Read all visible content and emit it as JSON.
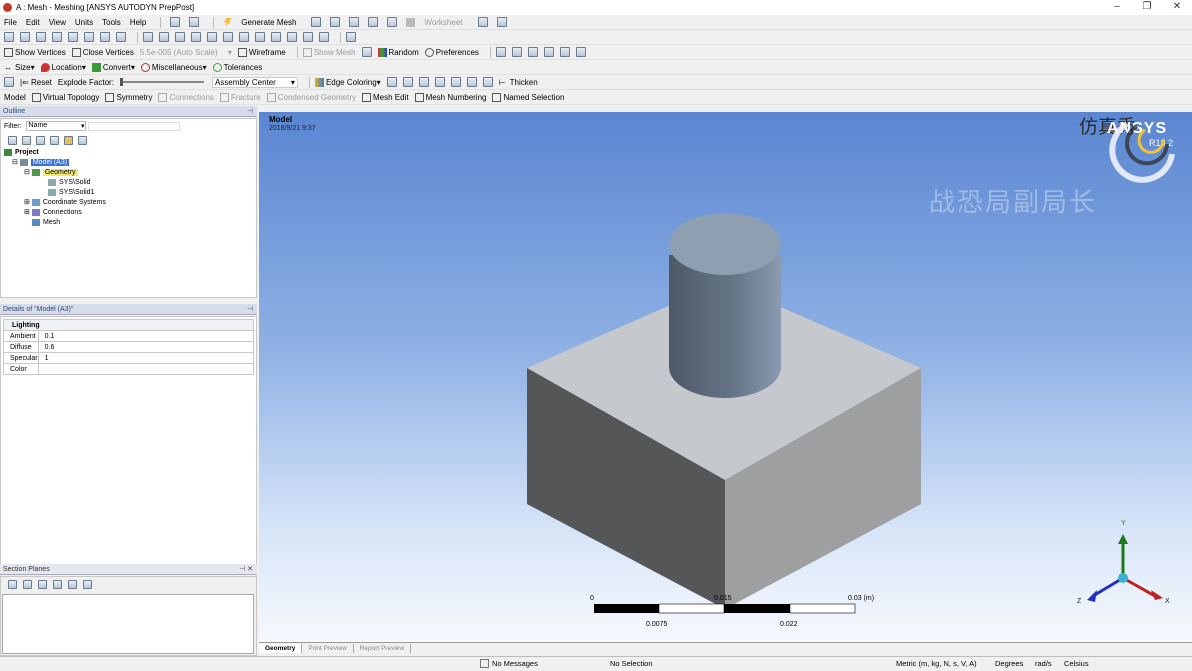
{
  "window": {
    "title": "A : Mesh - Meshing [ANSYS AUTODYN PrepPost]",
    "minimize": "–",
    "restore": "❐",
    "close": "✕"
  },
  "menu": [
    "File",
    "Edit",
    "View",
    "Units",
    "Tools",
    "Help"
  ],
  "toolbar1": {
    "generate_mesh": "Generate Mesh",
    "worksheet": "Worksheet"
  },
  "toolbar2": {
    "show_vertices": "Show Vertices",
    "close_vertices": "Close Vertices",
    "auto_scale": "5.5e-005 (Auto Scale)",
    "wireframe": "Wireframe",
    "show_mesh": "Show Mesh",
    "random": "Random",
    "preferences": "Preferences"
  },
  "toolbar3": {
    "size": "Size",
    "location": "Location",
    "convert": "Convert",
    "miscellaneous": "Miscellaneous",
    "tolerances": "Tolerances"
  },
  "toolbar4": {
    "reset": "Reset",
    "explode_factor": "Explode Factor:",
    "assembly_center": "Assembly Center",
    "edge_coloring": "Edge Coloring",
    "thicken": "Thicken"
  },
  "toolbar5": {
    "model": "Model",
    "virtual_topology": "Virtual Topology",
    "symmetry": "Symmetry",
    "connections": "Connections",
    "fracture": "Fracture",
    "condensed_geometry": "Condensed Geometry",
    "mesh_edit": "Mesh Edit",
    "mesh_numbering": "Mesh Numbering",
    "named_selection": "Named Selection"
  },
  "outline": {
    "header": "Outline",
    "filter_label": "Filter:",
    "filter_value": "Name",
    "tree": {
      "project": "Project",
      "model": "Model (A3)",
      "geometry": "Geometry",
      "solid": "SYS\\Solid",
      "solid1": "SYS\\Solid1",
      "coord": "Coordinate Systems",
      "connections": "Connections",
      "mesh": "Mesh"
    }
  },
  "details": {
    "header": "Details of \"Model (A3)\"",
    "group": "Lighting",
    "rows": [
      {
        "key": "Ambient",
        "value": "0.1"
      },
      {
        "key": "Diffuse",
        "value": "0.6"
      },
      {
        "key": "Specular",
        "value": "1"
      },
      {
        "key": "Color",
        "value": ""
      }
    ]
  },
  "section_planes": {
    "header": "Section Planes"
  },
  "viewport": {
    "title": "Model",
    "date": "2018/9/21 9:37",
    "watermark": "战恐局副局长",
    "logo_cn": "仿真秀",
    "brand": "ANSYS",
    "version": "R18.2",
    "scale": {
      "zero": "0",
      "mid": "0.015",
      "max": "0.03 (m)",
      "q1": "0.0075",
      "q3": "0.022"
    },
    "axes": {
      "y": "Y",
      "x": "X",
      "z": "Z"
    }
  },
  "bottom_tabs": [
    "Geometry",
    "Print Preview",
    "Report Preview"
  ],
  "status": {
    "messages": "No Messages",
    "selection": "No Selection",
    "units": "Metric (m, kg, N, s, V, A)",
    "angle": "Degrees",
    "rotation": "rad/s",
    "temp": "Celsius"
  }
}
